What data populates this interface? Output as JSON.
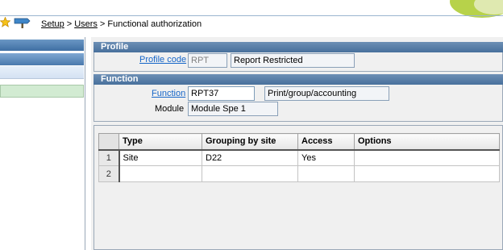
{
  "breadcrumb": {
    "items": [
      "Setup",
      "Users",
      "Functional authorization"
    ],
    "separator": ">"
  },
  "toolbar": {
    "favorite_icon": "star-icon",
    "navigate_icon": "signpost-icon"
  },
  "sidebar": {
    "collapse_icon": "double-chevron-down-icon",
    "expand_icon": "double-chevron-up-icon"
  },
  "profile": {
    "section_title": "Profile",
    "code_label": "Profile code",
    "code_value": "RPT",
    "description_value": "Report Restricted"
  },
  "function": {
    "section_title": "Function",
    "function_label": "Function",
    "function_value": "RPT37",
    "function_description": "Print/group/accounting",
    "module_label": "Module",
    "module_value": "Module Spe 1"
  },
  "grid": {
    "columns": [
      "Type",
      "Grouping by site",
      "Access",
      "Options"
    ],
    "rows": [
      {
        "num": "1",
        "type": "Site",
        "grouping": "D22",
        "access": "Yes",
        "options": ""
      },
      {
        "num": "2",
        "type": "",
        "grouping": "",
        "access": "",
        "options": ""
      }
    ]
  },
  "colors": {
    "section_header": "#48709c",
    "link": "#1666c8",
    "selected_row": "#d2ebd2"
  }
}
